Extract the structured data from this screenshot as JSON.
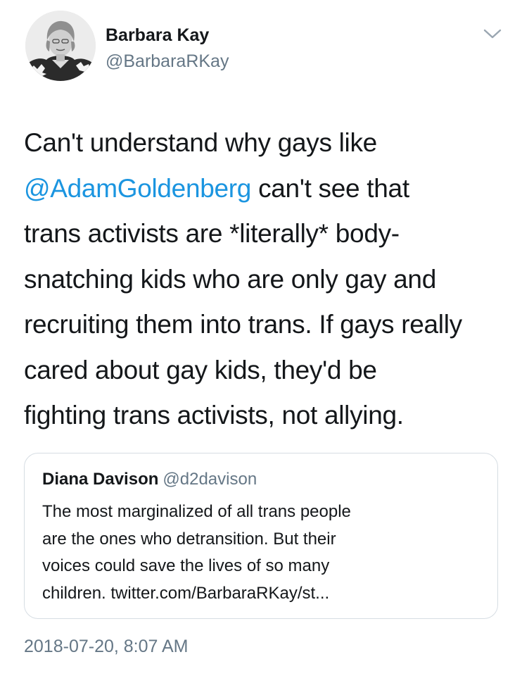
{
  "author": {
    "name": "Barbara Kay",
    "handle": "@BarbaraRKay"
  },
  "icons": {
    "menu": "chevron-down-icon",
    "avatar": "profile-photo"
  },
  "tweet": {
    "lines": [
      {
        "text": "Can't understand why gays like"
      },
      {
        "mention": "@AdamGoldenberg",
        "text": " can't see that"
      },
      {
        "text": "trans activists are *literally* body-"
      },
      {
        "text": "snatching kids who are only gay and"
      },
      {
        "text": "recruiting them into trans. If gays really"
      },
      {
        "text": "cared about gay kids, they'd be"
      },
      {
        "text": "fighting trans activists, not allying."
      }
    ]
  },
  "quote": {
    "name": "Diana Davison",
    "handle": "@d2davison",
    "lines": [
      "The most marginalized of all trans people",
      "are the ones who detransition. But their",
      "voices could save the lives of so many",
      "children. twitter.com/BarbaraRKay/st..."
    ]
  },
  "timestamp": "2018-07-20, 8:07 AM",
  "colors": {
    "link": "#1b95e0",
    "secondary_text": "#657786",
    "card_border": "#d6dde3"
  }
}
